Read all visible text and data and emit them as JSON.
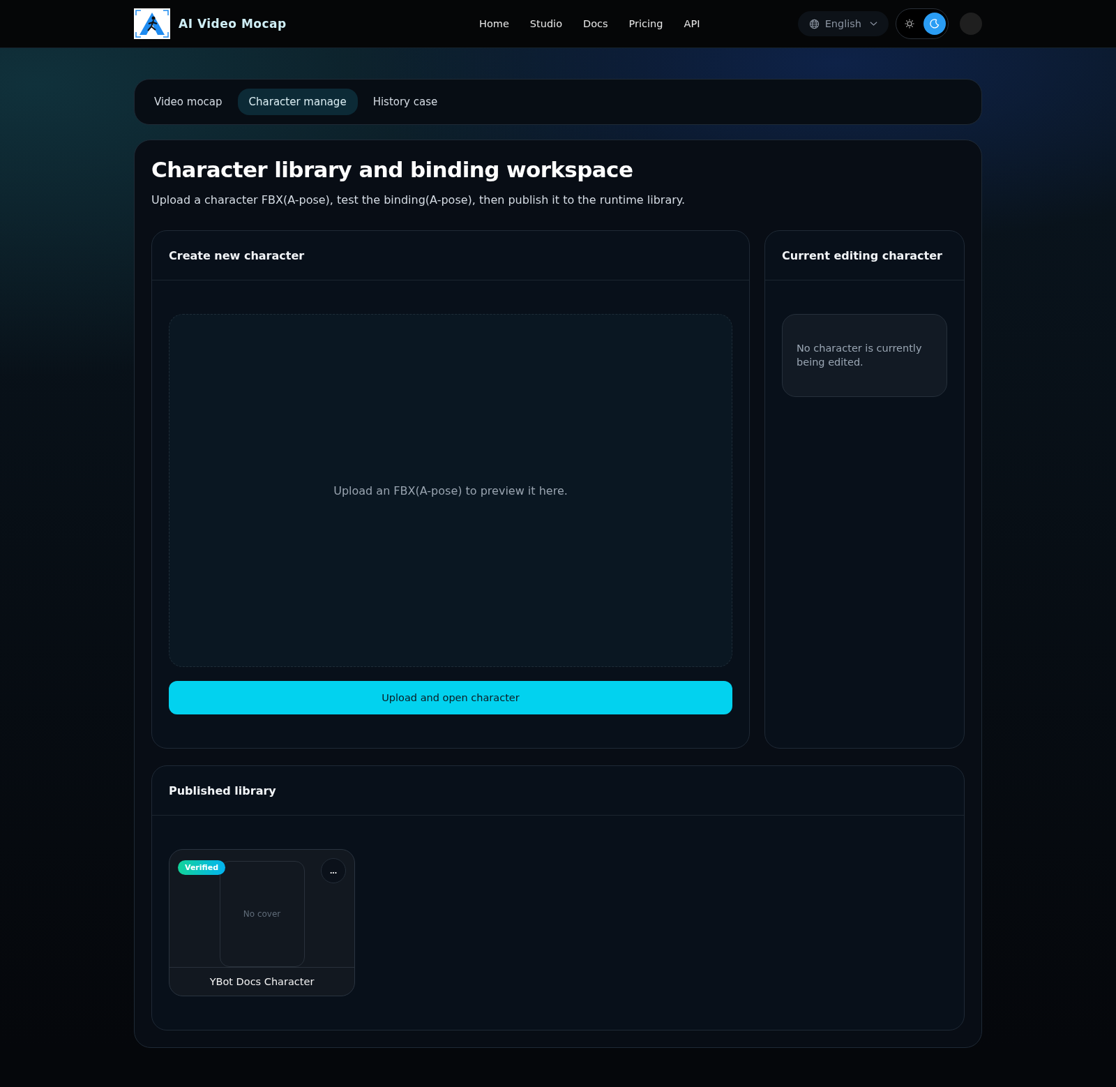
{
  "header": {
    "brand": "AI Video Mocap",
    "nav": [
      {
        "label": "Home"
      },
      {
        "label": "Studio"
      },
      {
        "label": "Docs"
      },
      {
        "label": "Pricing"
      },
      {
        "label": "API"
      }
    ],
    "language": "English",
    "theme": [
      {
        "kind": "light",
        "selected": false
      },
      {
        "kind": "dark",
        "selected": true
      }
    ]
  },
  "tabs": [
    {
      "label": "Video mocap",
      "selected": false
    },
    {
      "label": "Character manage",
      "selected": true
    },
    {
      "label": "History case",
      "selected": false
    }
  ],
  "workspace": {
    "title": "Character library and binding workspace",
    "subtitle": "Upload a character FBX(A-pose), test the binding(A-pose), then publish it to the runtime library.",
    "create": {
      "title": "Create new character",
      "preview_hint": "Upload an FBX(A-pose) to preview it here.",
      "button": "Upload and open character"
    },
    "current": {
      "title": "Current editing character",
      "empty": "No character is currently being edited."
    },
    "library": {
      "title": "Published library",
      "items": [
        {
          "badge": "Verified",
          "cover": "No cover",
          "menu": "...",
          "name": "YBot Docs Character"
        }
      ]
    }
  }
}
